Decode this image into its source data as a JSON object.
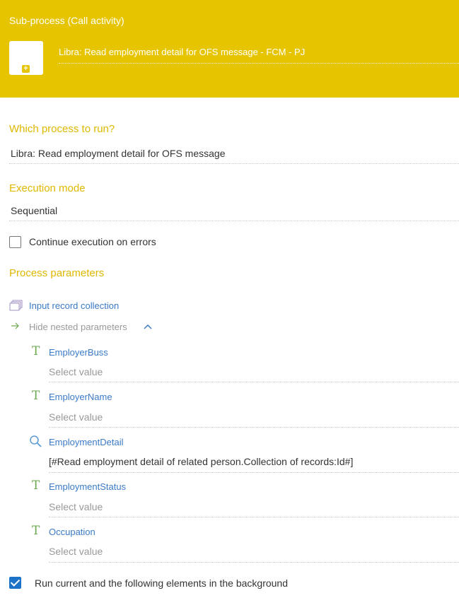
{
  "header": {
    "title": "Sub-process (Call activity)",
    "element_name": "Libra: Read employment detail for OFS message - FCM - PJ"
  },
  "process_to_run": {
    "label": "Which process to run?",
    "value": "Libra: Read employment detail for OFS message"
  },
  "execution_mode": {
    "label": "Execution mode",
    "value": "Sequential"
  },
  "continue_on_errors": {
    "label": "Continue execution on errors",
    "checked": false
  },
  "process_parameters": {
    "label": "Process parameters",
    "collection_label": "Input record collection",
    "hide_nested_label": "Hide nested parameters",
    "params": [
      {
        "icon": "text-type-icon",
        "name": "EmployerBuss",
        "value": "Select value"
      },
      {
        "icon": "text-type-icon",
        "name": "EmployerName",
        "value": "Select value"
      },
      {
        "icon": "lookup-icon",
        "name": "EmploymentDetail",
        "value": "[#Read employment detail of related person.Collection of records:Id#]"
      },
      {
        "icon": "text-type-icon",
        "name": "EmploymentStatus",
        "value": "Select value"
      },
      {
        "icon": "text-type-icon",
        "name": "Occupation",
        "value": "Select value"
      }
    ]
  },
  "run_in_background": {
    "label": "Run current and the following elements in the background",
    "checked": true
  },
  "colors": {
    "header_bg": "#e6c500",
    "label_gold": "#e0b800",
    "link_blue": "#3a7ac8",
    "checkbox_blue": "#1c73c7",
    "type_green": "#6aa84f"
  }
}
